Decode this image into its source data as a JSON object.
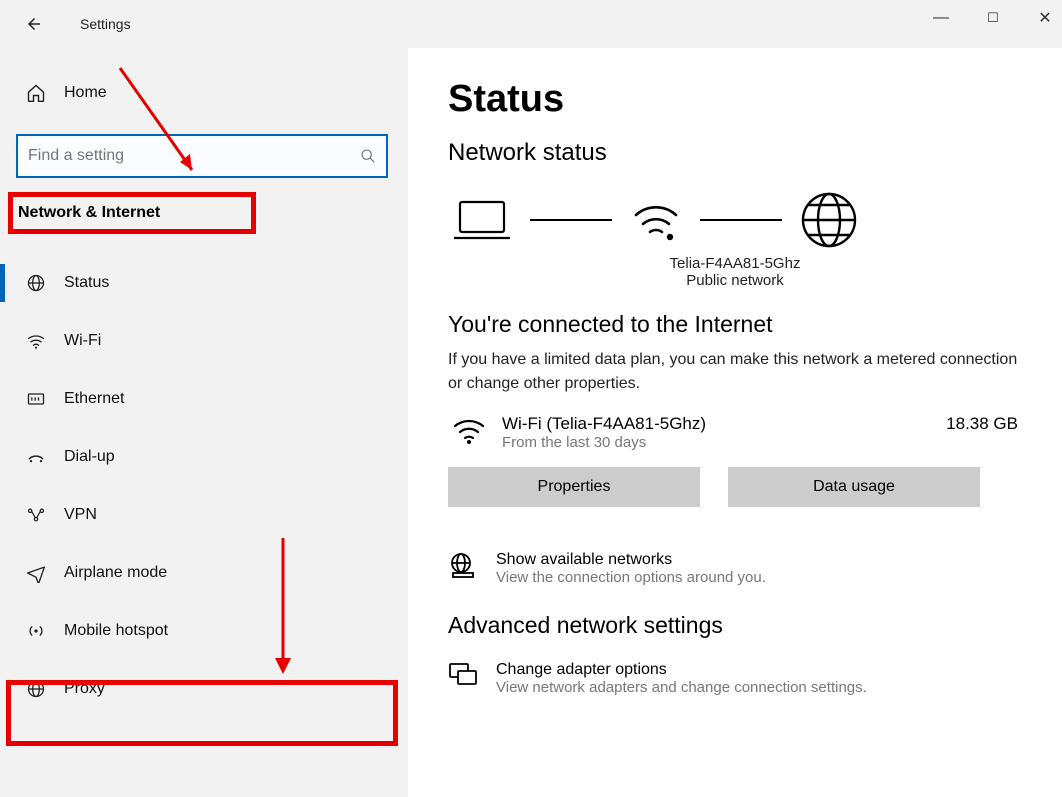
{
  "window": {
    "title": "Settings"
  },
  "sidebar": {
    "home": "Home",
    "search_placeholder": "Find a setting",
    "section": "Network & Internet",
    "items": [
      {
        "label": "Status"
      },
      {
        "label": "Wi-Fi"
      },
      {
        "label": "Ethernet"
      },
      {
        "label": "Dial-up"
      },
      {
        "label": "VPN"
      },
      {
        "label": "Airplane mode"
      },
      {
        "label": "Mobile hotspot"
      },
      {
        "label": "Proxy"
      }
    ]
  },
  "content": {
    "title": "Status",
    "subtitle": "Network status",
    "diagram_ssid": "Telia-F4AA81-5Ghz",
    "diagram_type": "Public network",
    "connected_heading": "You're connected to the Internet",
    "connected_body": "If you have a limited data plan, you can make this network a metered connection or change other properties.",
    "conn_name": "Wi-Fi (Telia-F4AA81-5Ghz)",
    "conn_sub": "From the last 30 days",
    "conn_usage": "18.38 GB",
    "btn_properties": "Properties",
    "btn_data_usage": "Data usage",
    "show_networks": "Show available networks",
    "show_networks_sub": "View the connection options around you.",
    "advanced_heading": "Advanced network settings",
    "adapter_title": "Change adapter options",
    "adapter_sub": "View network adapters and change connection settings."
  }
}
